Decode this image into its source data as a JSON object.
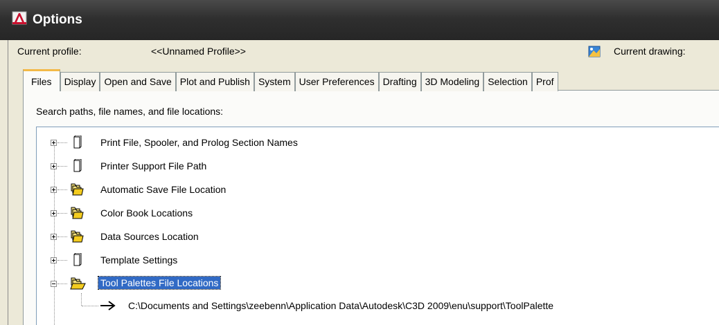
{
  "window": {
    "title": "Options",
    "icon": "autocad-app-icon"
  },
  "profile": {
    "label": "Current profile:",
    "value": "<<Unnamed Profile>>"
  },
  "drawing": {
    "label": "Current drawing:",
    "icon": "drawing-file-icon"
  },
  "tabs": [
    {
      "label": "Files",
      "active": true
    },
    {
      "label": "Display"
    },
    {
      "label": "Open and Save"
    },
    {
      "label": "Plot and Publish"
    },
    {
      "label": "System"
    },
    {
      "label": "User Preferences"
    },
    {
      "label": "Drafting"
    },
    {
      "label": "3D Modeling"
    },
    {
      "label": "Selection"
    },
    {
      "label": "Prof"
    }
  ],
  "section_label": "Search paths, file names, and file locations:",
  "tree": {
    "items": [
      {
        "label": "Print File, Spooler, and Prolog Section Names",
        "icon": "document-icon",
        "expanded": false
      },
      {
        "label": "Printer Support File Path",
        "icon": "document-icon",
        "expanded": false
      },
      {
        "label": "Automatic Save File Location",
        "icon": "folders-icon",
        "expanded": false
      },
      {
        "label": "Color Book Locations",
        "icon": "folders-icon",
        "expanded": false
      },
      {
        "label": "Data Sources Location",
        "icon": "folders-icon",
        "expanded": false
      },
      {
        "label": "Template Settings",
        "icon": "document-icon",
        "expanded": false
      },
      {
        "label": "Tool Palettes File Locations",
        "icon": "open-folders-icon",
        "expanded": true,
        "selected": true
      }
    ],
    "child_path": "C:\\Documents and Settings\\zeebenn\\Application Data\\Autodesk\\C3D 2009\\enu\\support\\ToolPalette"
  },
  "colors": {
    "title_bar": "#2f2f2f",
    "selection": "#316ac5",
    "tab_highlight": "#f3b948",
    "dialog_bg": "#ece9d8"
  }
}
